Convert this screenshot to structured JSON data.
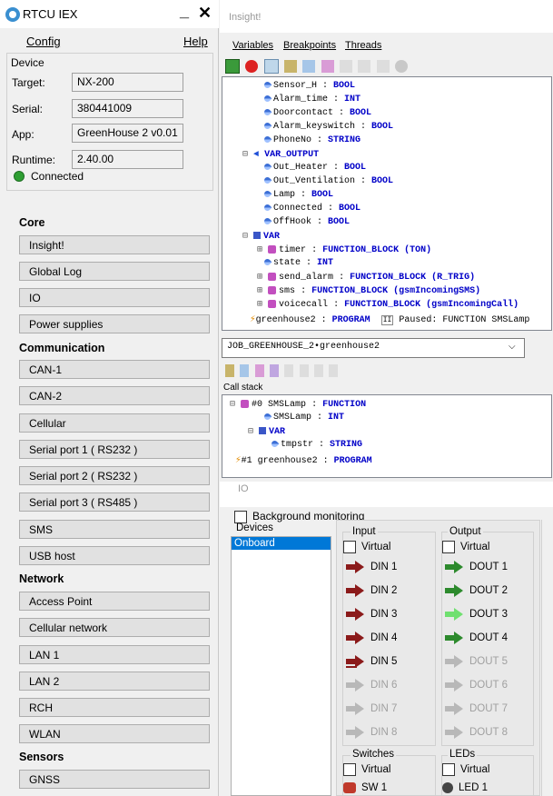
{
  "app": {
    "title": "RTCU IEX",
    "min_symbol": "_",
    "close_symbol": "✕"
  },
  "menu": {
    "config": "Config",
    "help": "Help"
  },
  "device": {
    "section_label": "Device",
    "target_label": "Target:",
    "target": "NX-200",
    "serial_label": "Serial:",
    "serial": "380441009",
    "app_label": "App:",
    "app": "GreenHouse 2 v0.01",
    "runtime_label": "Runtime:",
    "runtime": "2.40.00",
    "status": "Connected",
    "status_color": "#2e9e32"
  },
  "nav": {
    "core_title": "Core",
    "core": [
      "Insight!",
      "Global Log",
      "IO",
      "Power supplies"
    ],
    "comm_title": "Communication",
    "comm": [
      "CAN-1",
      "CAN-2",
      "Cellular",
      "Serial port 1 ( RS232 )",
      "Serial port 2 ( RS232 )",
      "Serial port 3 ( RS485 )",
      "SMS",
      "USB host"
    ],
    "net_title": "Network",
    "net": [
      "Access Point",
      "Cellular network",
      "LAN 1",
      "LAN 2",
      "RCH",
      "WLAN"
    ],
    "sensors_title": "Sensors",
    "sensors": [
      "GNSS"
    ]
  },
  "insight": {
    "title": "Insight!",
    "menu": [
      "Variables",
      "Breakpoints",
      "Threads"
    ],
    "tree": [
      {
        "name": "Sensor_H",
        "type": "BOOL",
        "kind": "var"
      },
      {
        "name": "Alarm_time",
        "type": "INT",
        "kind": "var"
      },
      {
        "name": "Doorcontact",
        "type": "BOOL",
        "kind": "var"
      },
      {
        "name": "Alarm_keyswitch",
        "type": "BOOL",
        "kind": "var"
      },
      {
        "name": "PhoneNo",
        "type": "STRING",
        "kind": "var"
      },
      {
        "name": "VAR_OUTPUT",
        "type": "",
        "kind": "section"
      },
      {
        "name": "Out_Heater",
        "type": "BOOL",
        "kind": "var"
      },
      {
        "name": "Out_Ventilation",
        "type": "BOOL",
        "kind": "var"
      },
      {
        "name": "Lamp",
        "type": "BOOL",
        "kind": "var"
      },
      {
        "name": "Connected",
        "type": "BOOL",
        "kind": "var"
      },
      {
        "name": "OffHook",
        "type": "BOOL",
        "kind": "var"
      },
      {
        "name": "VAR",
        "type": "",
        "kind": "section"
      },
      {
        "name": "timer",
        "type": "FUNCTION_BLOCK (TON)",
        "kind": "fb"
      },
      {
        "name": "state",
        "type": "INT",
        "kind": "var"
      },
      {
        "name": "send_alarm",
        "type": "FUNCTION_BLOCK (R_TRIG)",
        "kind": "fb"
      },
      {
        "name": "sms",
        "type": "FUNCTION_BLOCK (gsmIncomingSMS)",
        "kind": "fb"
      },
      {
        "name": "voicecall",
        "type": "FUNCTION_BLOCK (gsmIncomingCall)",
        "kind": "fb"
      },
      {
        "name": "greenhouse2",
        "type": "PROGRAM",
        "kind": "prog",
        "extra": "Paused: FUNCTION SMSLamp"
      }
    ],
    "job_combo": "JOB_GREENHOUSE_2•greenhouse2",
    "callstack_label": "Call stack",
    "callstack": [
      {
        "text": "#0 SMSLamp",
        "type": "FUNCTION"
      },
      {
        "text": "SMSLamp",
        "type": "INT"
      },
      {
        "text": "VAR",
        "type": ""
      },
      {
        "text": "tmpstr",
        "type": "STRING"
      },
      {
        "text": "#1 greenhouse2",
        "type": "PROGRAM"
      }
    ]
  },
  "io": {
    "title": "IO",
    "bg_monitoring": "Background monitoring",
    "devices_label": "Devices",
    "devices": [
      "Onboard"
    ],
    "input_label": "Input",
    "output_label": "Output",
    "virtual_label": "Virtual",
    "inputs": [
      "DIN 1",
      "DIN 2",
      "DIN 3",
      "DIN 4",
      "DIN 5",
      "DIN 6",
      "DIN 7",
      "DIN 8"
    ],
    "outputs": [
      "DOUT 1",
      "DOUT 2",
      "DOUT 3",
      "DOUT 4",
      "DOUT 5",
      "DOUT 6",
      "DOUT 7",
      "DOUT 8"
    ],
    "switches_label": "Switches",
    "leds_label": "LEDs",
    "sw1": "SW 1",
    "led1": "LED 1",
    "colors": {
      "din_active": "#8b1a1a",
      "dout_active": "#2d8a2d",
      "dout_light": "#6fe06f",
      "disabled": "#b8b8b8"
    }
  }
}
